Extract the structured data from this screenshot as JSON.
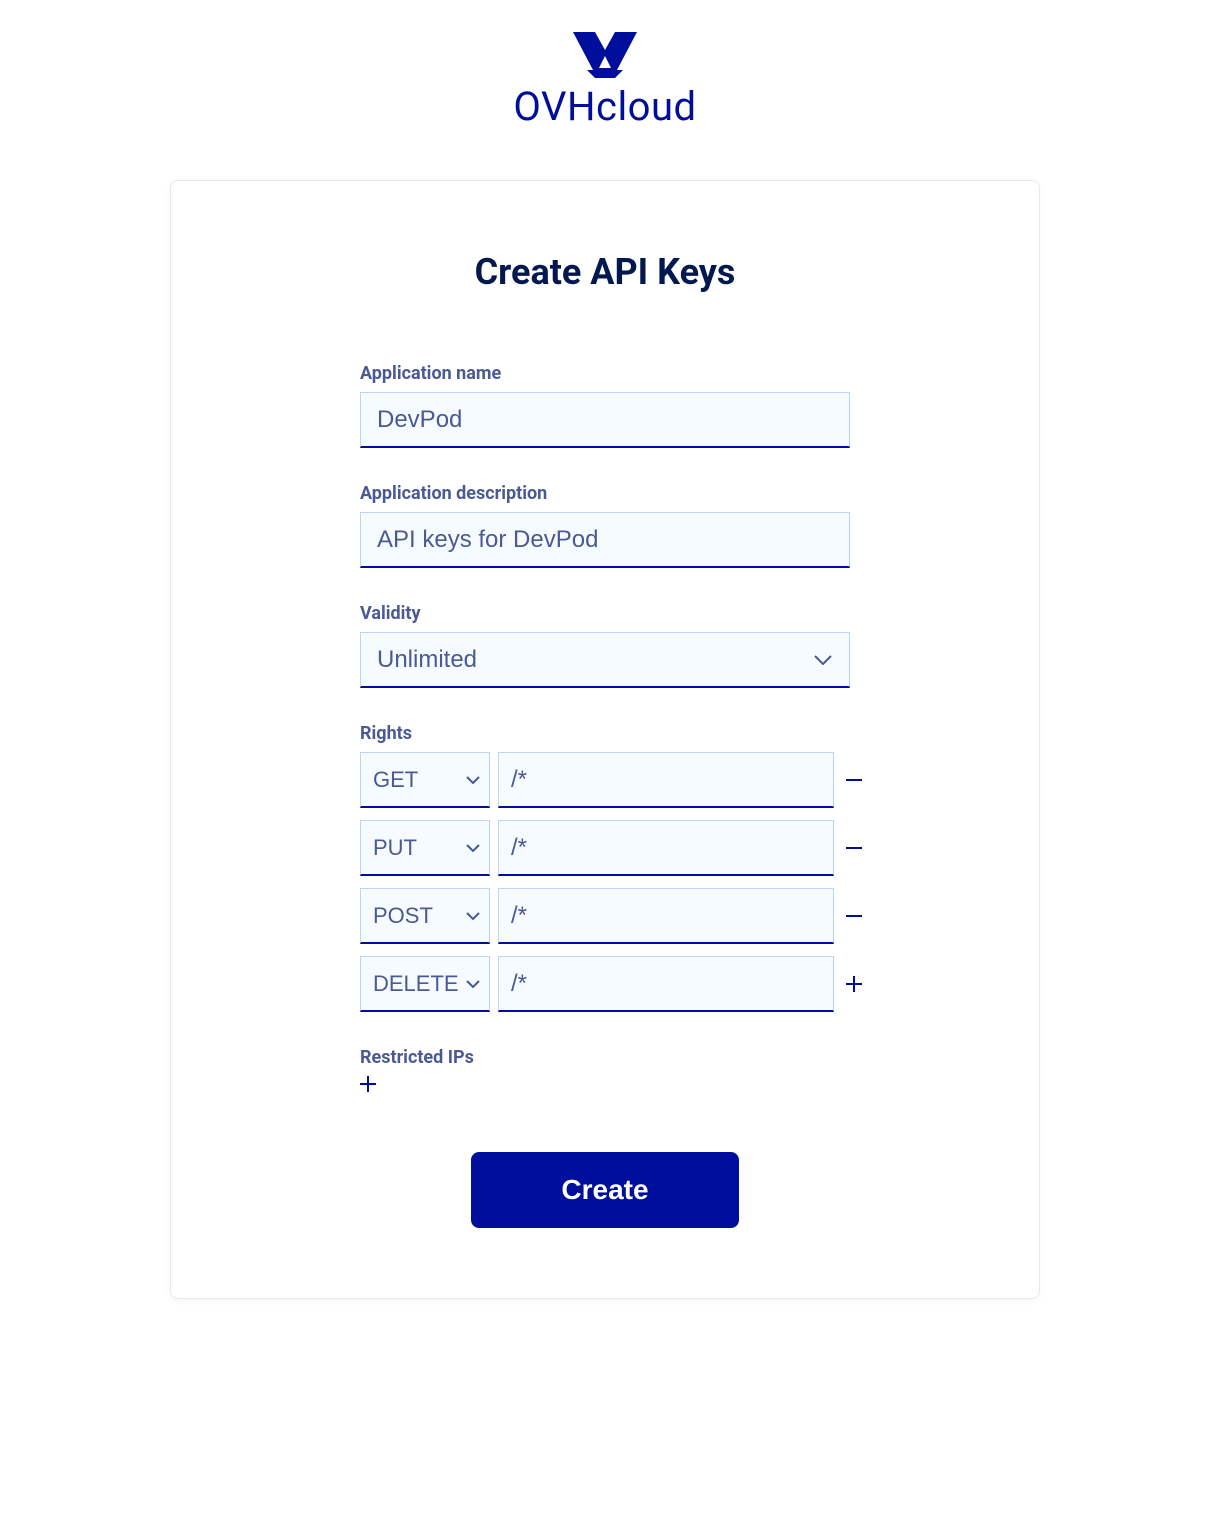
{
  "logo_text": "OVHcloud",
  "title": "Create API Keys",
  "fields": {
    "app_name": {
      "label": "Application name",
      "value": "DevPod"
    },
    "app_description": {
      "label": "Application description",
      "value": "API keys for DevPod"
    },
    "validity": {
      "label": "Validity",
      "value": "Unlimited"
    },
    "rights": {
      "label": "Rights",
      "rows": [
        {
          "method": "GET",
          "path": "/*",
          "action": "remove"
        },
        {
          "method": "PUT",
          "path": "/*",
          "action": "remove"
        },
        {
          "method": "POST",
          "path": "/*",
          "action": "remove"
        },
        {
          "method": "DELETE",
          "path": "/*",
          "action": "add"
        }
      ]
    },
    "restricted_ips": {
      "label": "Restricted IPs"
    }
  },
  "submit_label": "Create"
}
